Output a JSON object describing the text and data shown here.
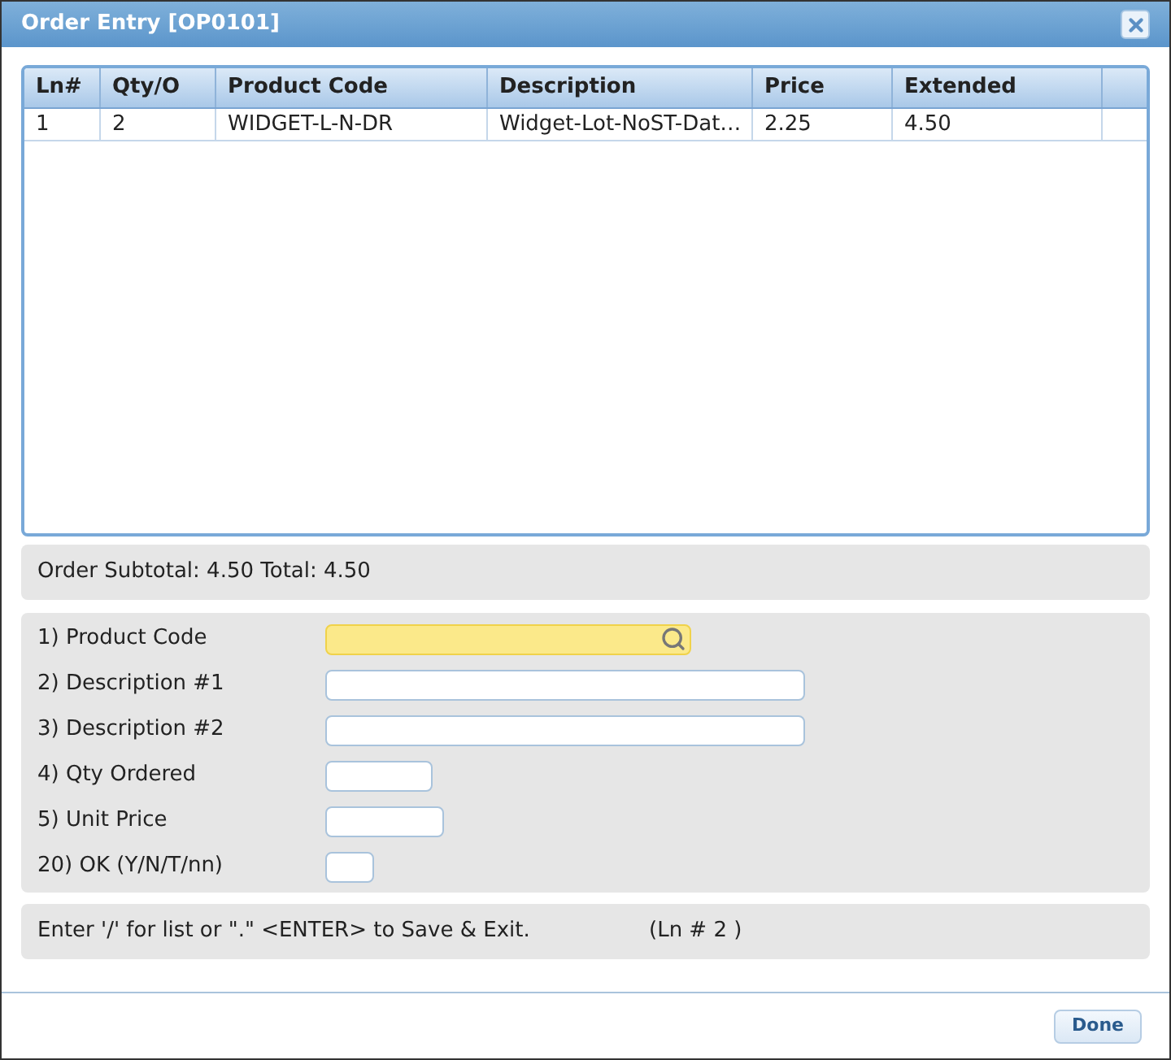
{
  "window": {
    "title": "Order Entry [OP0101]"
  },
  "table": {
    "columns": [
      "Ln#",
      "Qty/O",
      "Product Code",
      "Description",
      "Price",
      "Extended"
    ],
    "rows": [
      [
        "1",
        "2",
        "WIDGET-L-N-DR",
        "Widget-Lot-NoST-Dat…",
        "2.25",
        "4.50"
      ]
    ]
  },
  "totals": "Order Subtotal: 4.50 Total: 4.50",
  "form": {
    "fields": [
      {
        "label": "1) Product Code",
        "kind": "search",
        "focused": true
      },
      {
        "label": "2) Description #1",
        "kind": "text",
        "focused": false
      },
      {
        "label": "3) Description #2",
        "kind": "text",
        "focused": false
      },
      {
        "label": "4) Qty Ordered",
        "kind": "text",
        "focused": false
      },
      {
        "label": "5) Unit Price",
        "kind": "text",
        "focused": false
      },
      {
        "label": "20) OK (Y/N/T/nn)",
        "kind": "text",
        "focused": false
      }
    ]
  },
  "status": {
    "message": "Enter '/' for list or \".\" <ENTER> to Save & Exit.",
    "line": "(Ln # 2 )"
  },
  "buttons": [
    "Done"
  ]
}
